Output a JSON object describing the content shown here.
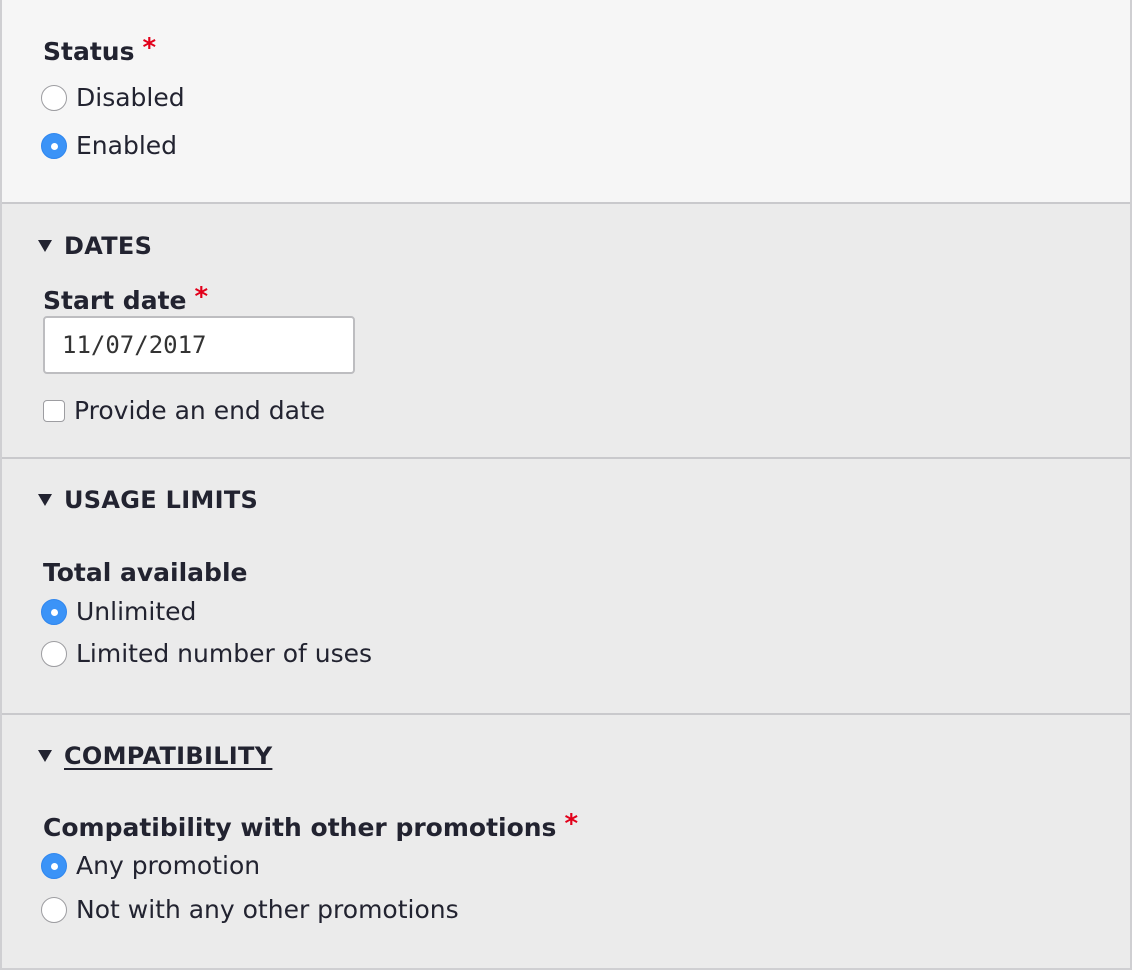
{
  "status": {
    "label": "Status",
    "required_mark": "*",
    "options": [
      {
        "label": "Disabled",
        "checked": false
      },
      {
        "label": "Enabled",
        "checked": true
      }
    ]
  },
  "dates": {
    "summary": "DATES",
    "start_date": {
      "label": "Start date",
      "required_mark": "*",
      "value": "11/07/2017"
    },
    "end_date_checkbox": {
      "label": "Provide an end date",
      "checked": false
    }
  },
  "usage_limits": {
    "summary": "USAGE LIMITS",
    "total_available": {
      "label": "Total available",
      "options": [
        {
          "label": "Unlimited",
          "checked": true
        },
        {
          "label": "Limited number of uses",
          "checked": false
        }
      ]
    }
  },
  "compatibility": {
    "summary": "COMPATIBILITY",
    "field": {
      "label": "Compatibility with other promotions",
      "required_mark": "*",
      "options": [
        {
          "label": "Any promotion",
          "checked": true
        },
        {
          "label": "Not with any other promotions",
          "checked": false
        }
      ]
    }
  },
  "colors": {
    "radio_checked": "#3b93f7",
    "required": "#e2001a",
    "panel_bg": "#ebebeb",
    "status_bg": "#f6f6f6"
  }
}
